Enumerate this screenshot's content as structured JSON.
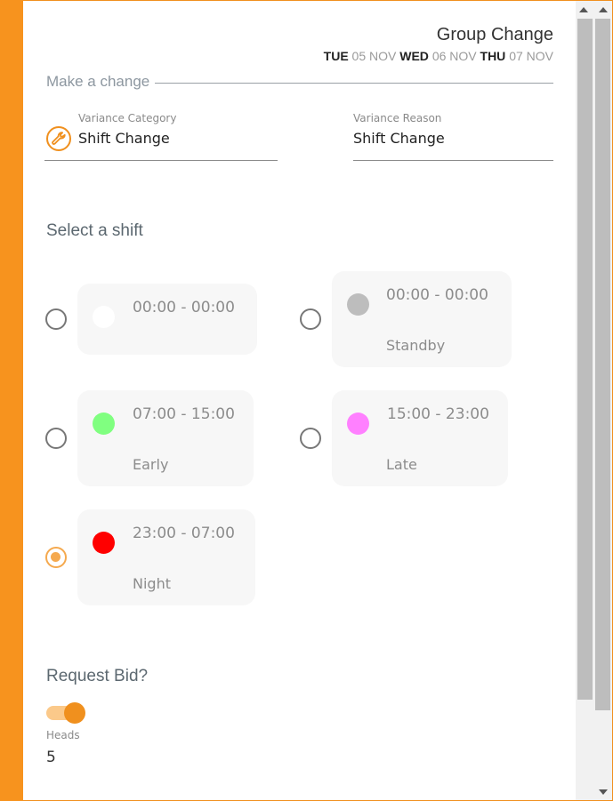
{
  "header": {
    "title": "Group Change",
    "dates": [
      {
        "dow": "TUE",
        "date": "05 NOV"
      },
      {
        "dow": "WED",
        "date": "06 NOV"
      },
      {
        "dow": "THU",
        "date": "07 NOV"
      }
    ]
  },
  "make_change": {
    "section_label": "Make a change",
    "variance_category": {
      "label": "Variance Category",
      "value": "Shift Change"
    },
    "variance_reason": {
      "label": "Variance Reason",
      "value": "Shift Change"
    }
  },
  "select_shift": {
    "heading": "Select a shift",
    "shifts": [
      {
        "time": "00:00 - 00:00",
        "name": "",
        "color": "#ffffff",
        "selected": false
      },
      {
        "time": "00:00 - 00:00",
        "name": "Standby",
        "color": "#bdbdbd",
        "selected": false
      },
      {
        "time": "07:00 - 15:00",
        "name": "Early",
        "color": "#80ff80",
        "selected": false
      },
      {
        "time": "15:00 - 23:00",
        "name": "Late",
        "color": "#ff80ff",
        "selected": false
      },
      {
        "time": "23:00 - 07:00",
        "name": "Night",
        "color": "#ff0000",
        "selected": true
      }
    ]
  },
  "request_bid": {
    "heading": "Request Bid?",
    "enabled": true,
    "heads_label": "Heads",
    "heads_value": "5"
  },
  "colors": {
    "accent": "#f7931e",
    "accent_light": "#fbc98a",
    "selected_radio": "#f5a94e"
  }
}
